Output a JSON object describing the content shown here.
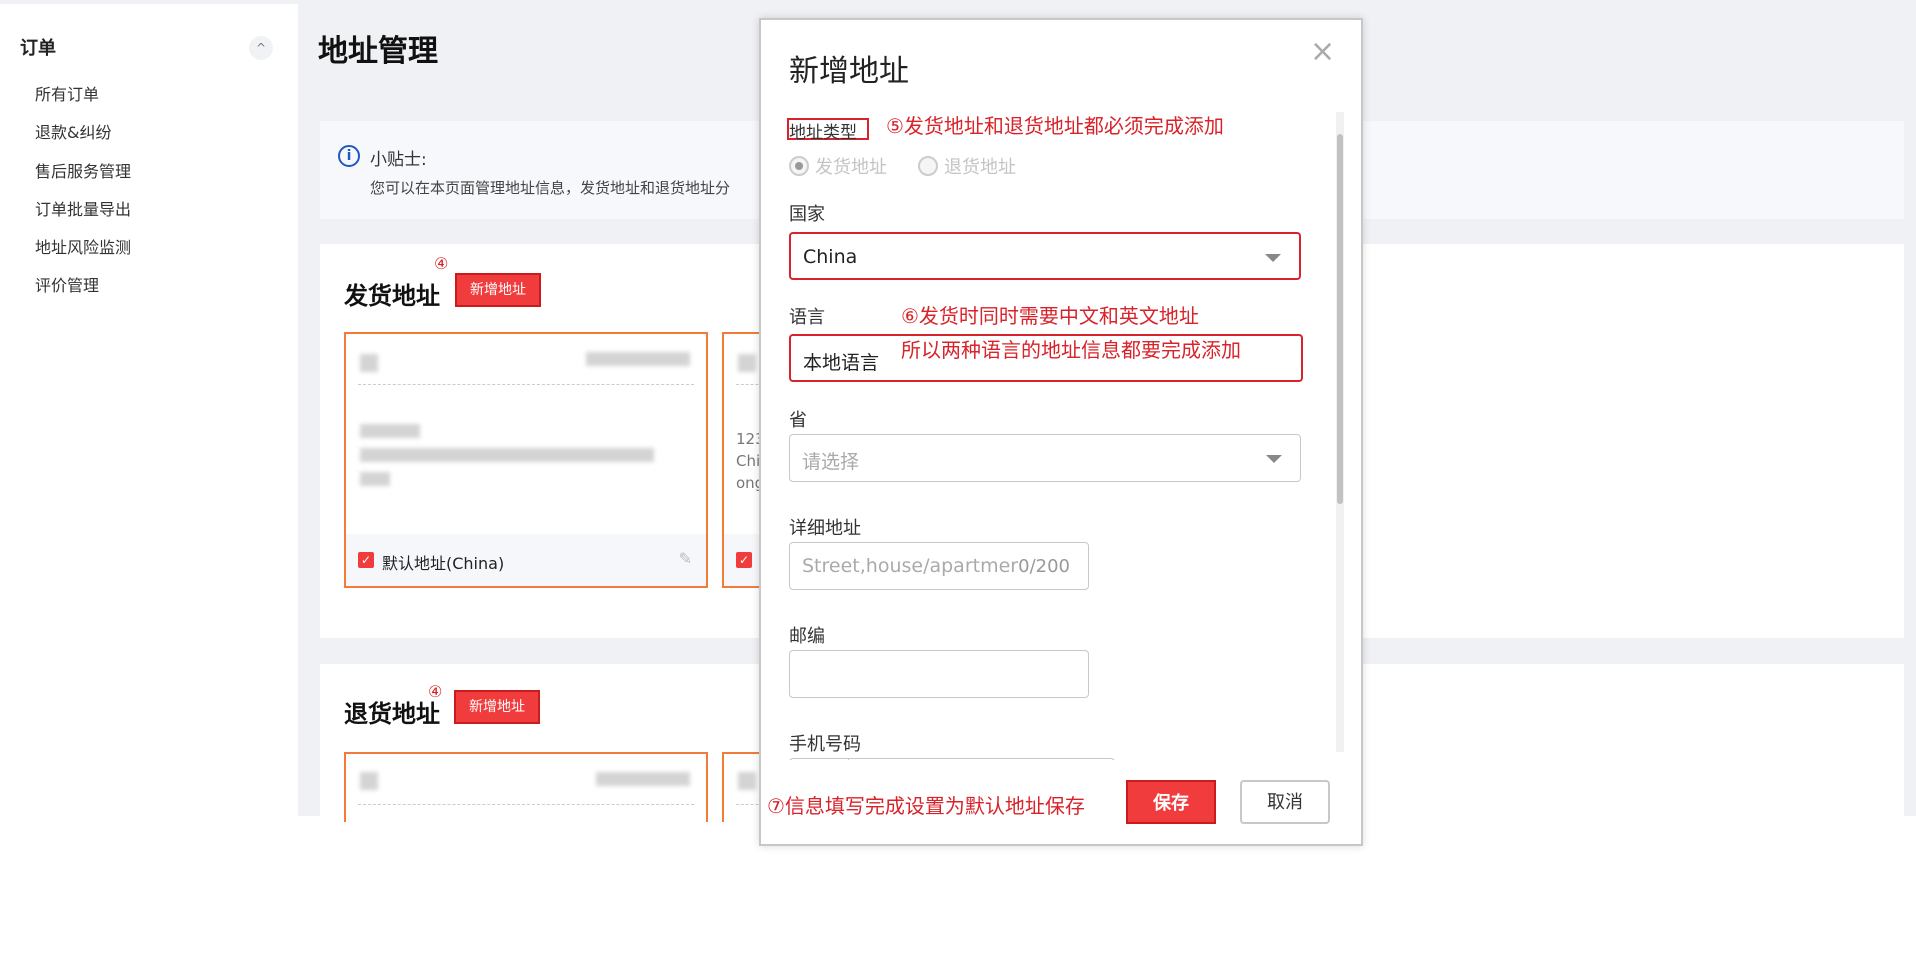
{
  "sidebar": {
    "heading": "订单",
    "toggle": "^",
    "items": [
      "所有订单",
      "退款&纠纷",
      "售后服务管理",
      "订单批量导出",
      "地址风险监测",
      "评价管理"
    ]
  },
  "main": {
    "title": "地址管理",
    "tips": {
      "icon": "i",
      "title": "小贴士:",
      "text": "您可以在本页面管理地址信息，发货地址和退货地址分"
    },
    "shipping": {
      "title": "发货地址",
      "annotation": "④",
      "add_button": "新增地址",
      "card": {
        "default_label": "默认地址(China)"
      },
      "partial_lines": [
        "123",
        "Chi",
        "ong"
      ]
    },
    "returns": {
      "title": "退货地址",
      "annotation": "④",
      "add_button": "新增地址"
    }
  },
  "modal": {
    "title": "新增地址",
    "close": "×",
    "type_label": "地址类型",
    "type_note": "⑤发货地址和退货地址都必须完成添加",
    "type_options": [
      "发货地址",
      "退货地址"
    ],
    "country_label": "国家",
    "country_value": "China",
    "language_label": "语言",
    "language_note_1": "⑥发货时同时需要中文和英文地址",
    "language_note_2": "所以两种语言的地址信息都要完成添加",
    "language_value": "本地语言",
    "province_label": "省",
    "province_placeholder": "请选择",
    "detail_label": "详细地址",
    "detail_placeholder": "Street,house/apartmer",
    "detail_counter": "0/200",
    "zip_label": "邮编",
    "phone_label": "手机号码",
    "footer_note": "⑦信息填写完成设置为默认地址保存",
    "save": "保存",
    "cancel": "取消"
  },
  "colors": {
    "accent": "#f03c3c",
    "annotation": "#d8232a",
    "card_border": "#f37b3a",
    "info": "#1e58c5"
  }
}
